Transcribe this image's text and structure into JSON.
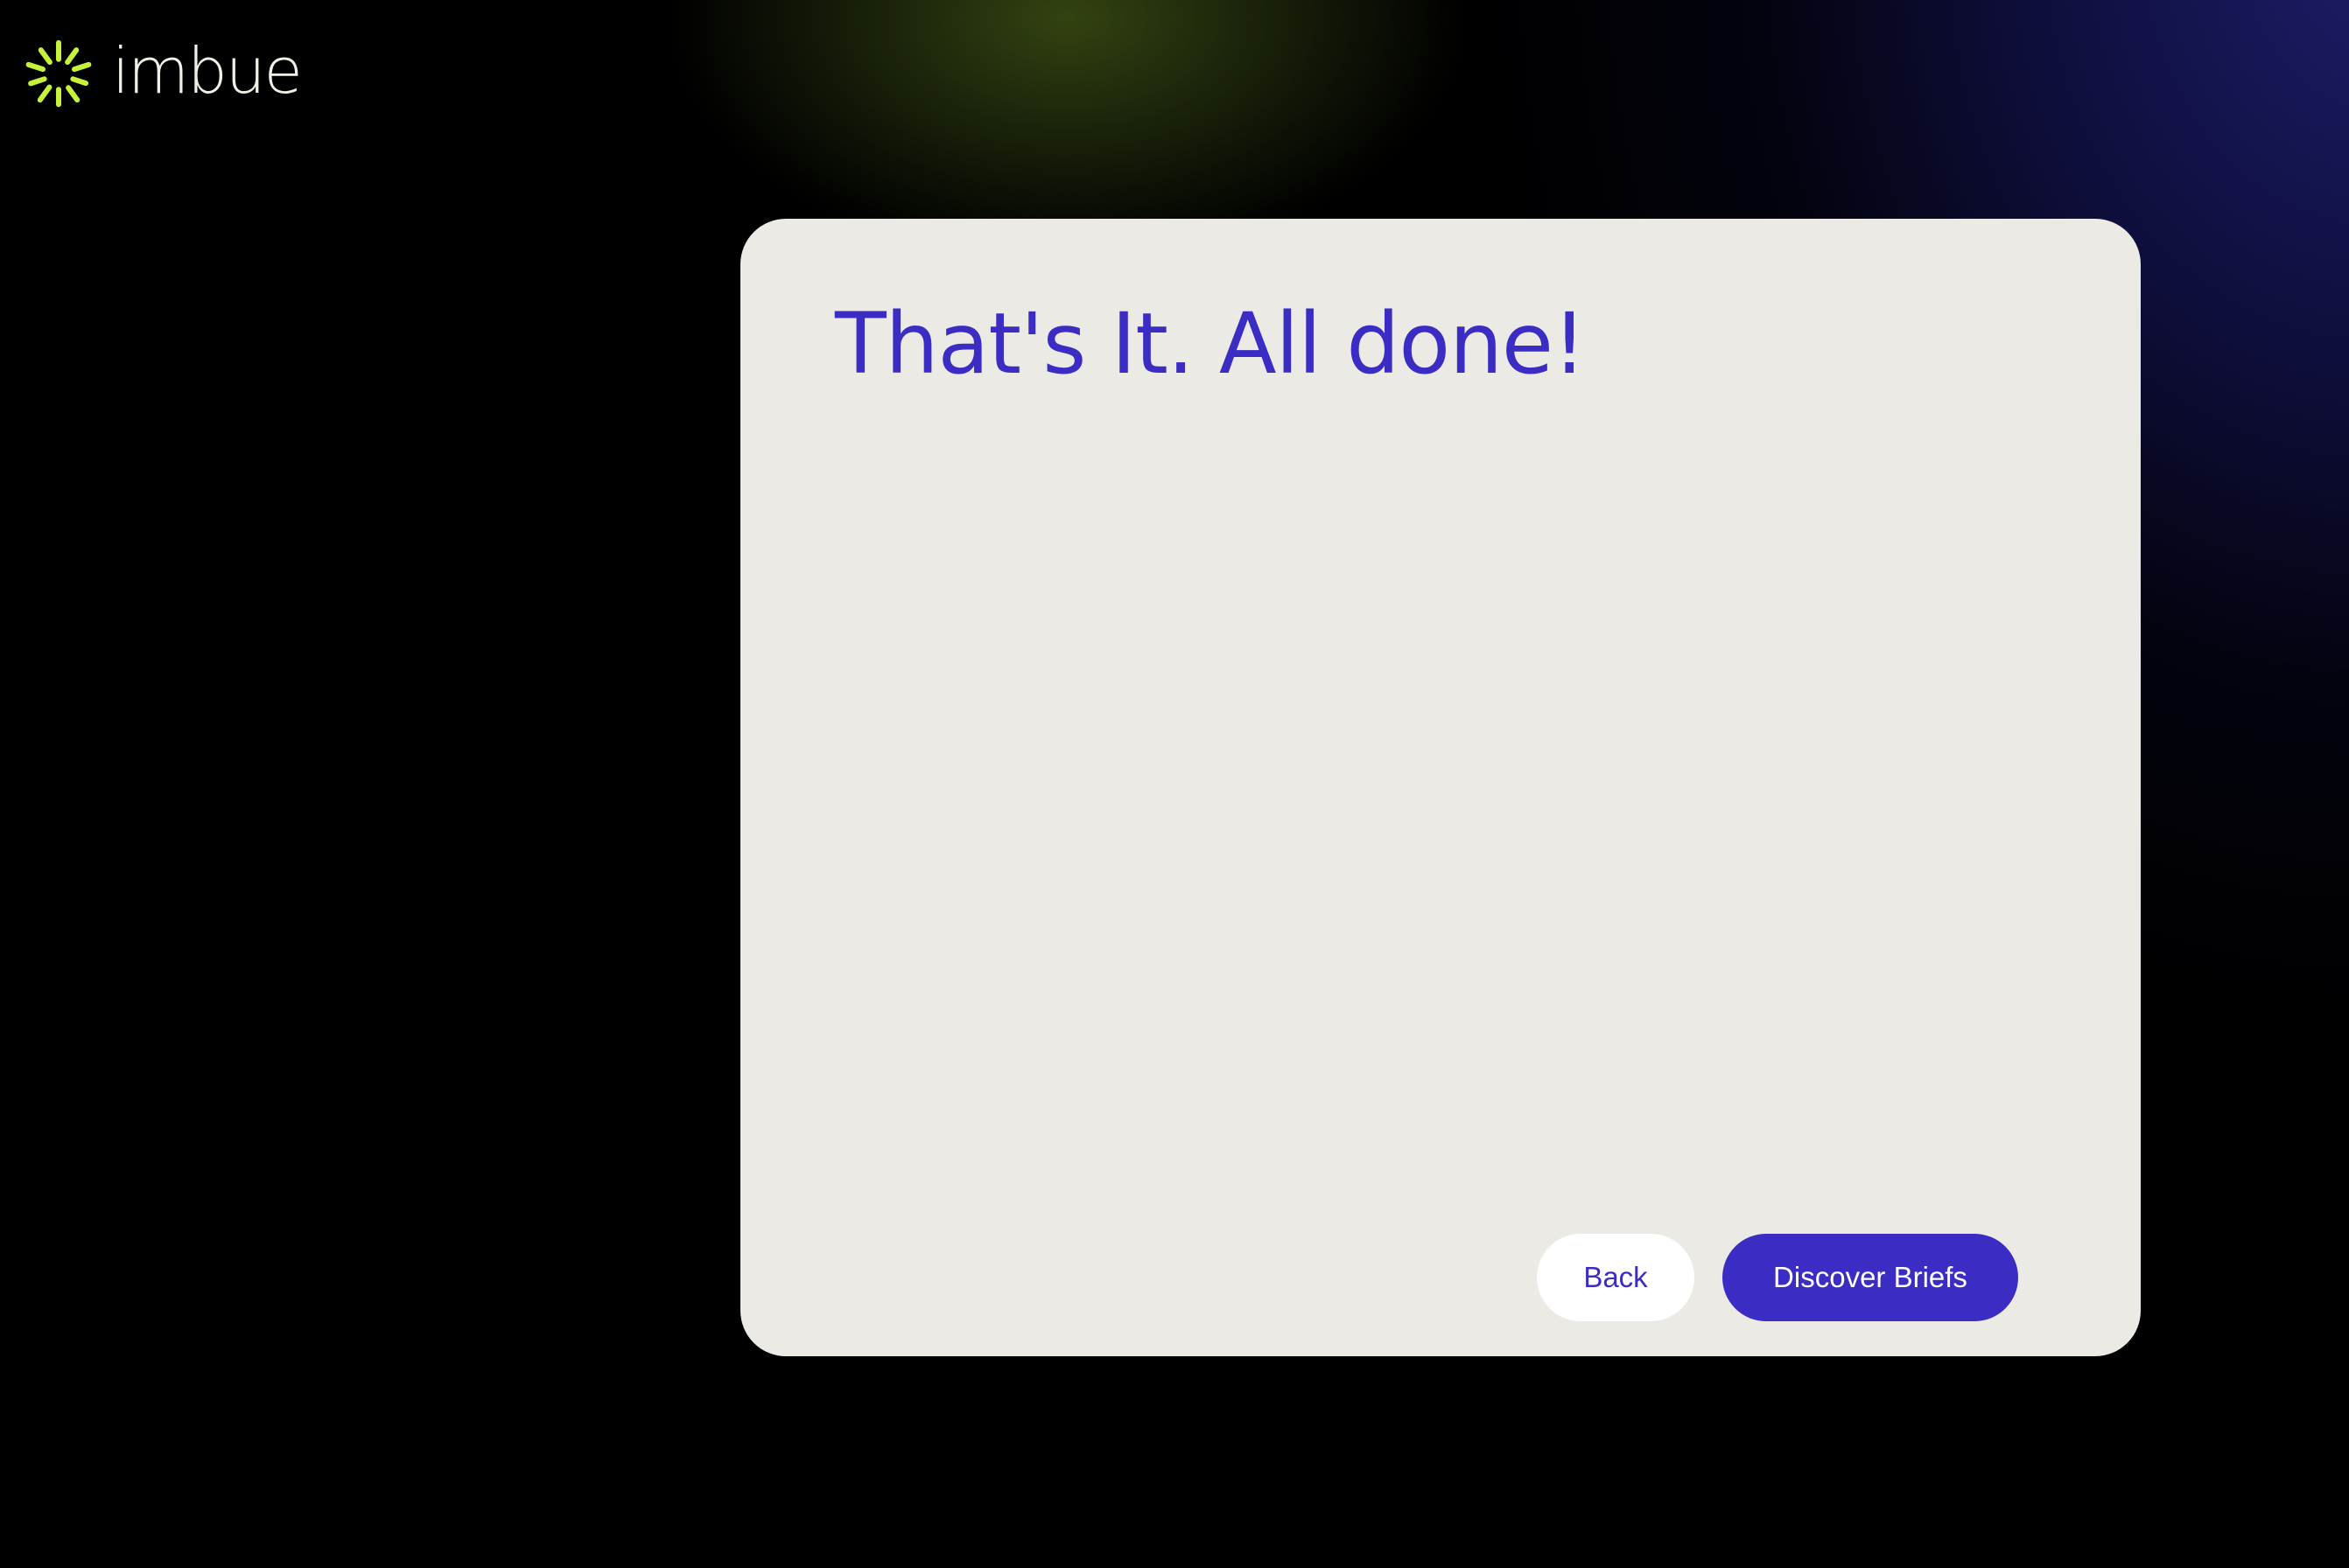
{
  "brand": {
    "name": "imbue",
    "logo_icon": "sunburst-logo-icon",
    "accent_color": "#c6f23c"
  },
  "colors": {
    "background": "#000000",
    "card_background": "#ebeae4",
    "primary": "#3b2cc3",
    "back_button_background": "#ffffff"
  },
  "dialog": {
    "title": "That's It. All done!",
    "back_label": "Back",
    "primary_label": "Discover Briefs"
  }
}
